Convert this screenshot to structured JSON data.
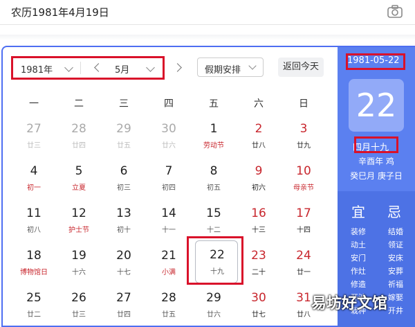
{
  "search": {
    "query": "农历1981年4月19日"
  },
  "toolbar": {
    "year": "1981年",
    "month": "5月",
    "holiday": "假期安排",
    "today": "返回今天"
  },
  "weekdays": [
    "一",
    "二",
    "三",
    "四",
    "五",
    "六",
    "日"
  ],
  "weeks": [
    [
      {
        "d": "27",
        "l": "廿三",
        "t": "gray"
      },
      {
        "d": "28",
        "l": "廿四",
        "t": "gray"
      },
      {
        "d": "29",
        "l": "廿五",
        "t": "gray"
      },
      {
        "d": "30",
        "l": "廿六",
        "t": "gray"
      },
      {
        "d": "1",
        "l": "劳动节",
        "t": "black",
        "lr": true
      },
      {
        "d": "2",
        "l": "廿八",
        "t": "red"
      },
      {
        "d": "3",
        "l": "廿九",
        "t": "red"
      }
    ],
    [
      {
        "d": "4",
        "l": "初一",
        "t": "black",
        "lr": true
      },
      {
        "d": "5",
        "l": "立夏",
        "t": "black",
        "lr": true
      },
      {
        "d": "6",
        "l": "初三",
        "t": "black"
      },
      {
        "d": "7",
        "l": "初四",
        "t": "black"
      },
      {
        "d": "8",
        "l": "初五",
        "t": "black"
      },
      {
        "d": "9",
        "l": "初六",
        "t": "red"
      },
      {
        "d": "10",
        "l": "母亲节",
        "t": "red",
        "lr": true
      }
    ],
    [
      {
        "d": "11",
        "l": "初八",
        "t": "black"
      },
      {
        "d": "12",
        "l": "护士节",
        "t": "black",
        "lr": true
      },
      {
        "d": "13",
        "l": "初十",
        "t": "black"
      },
      {
        "d": "14",
        "l": "十一",
        "t": "black"
      },
      {
        "d": "15",
        "l": "十二",
        "t": "black"
      },
      {
        "d": "16",
        "l": "十三",
        "t": "red"
      },
      {
        "d": "17",
        "l": "十四",
        "t": "red"
      }
    ],
    [
      {
        "d": "18",
        "l": "博物馆日",
        "t": "black",
        "lr": true
      },
      {
        "d": "19",
        "l": "十六",
        "t": "black"
      },
      {
        "d": "20",
        "l": "十七",
        "t": "black"
      },
      {
        "d": "21",
        "l": "小满",
        "t": "black",
        "lr": true
      },
      {
        "d": "22",
        "l": "十九",
        "t": "black",
        "sel": true
      },
      {
        "d": "23",
        "l": "二十",
        "t": "red"
      },
      {
        "d": "24",
        "l": "廿一",
        "t": "red"
      }
    ],
    [
      {
        "d": "25",
        "l": "廿二",
        "t": "black"
      },
      {
        "d": "26",
        "l": "廿三",
        "t": "black"
      },
      {
        "d": "27",
        "l": "廿四",
        "t": "black"
      },
      {
        "d": "28",
        "l": "廿五",
        "t": "black"
      },
      {
        "d": "29",
        "l": "廿六",
        "t": "black"
      },
      {
        "d": "30",
        "l": "廿七",
        "t": "red"
      },
      {
        "d": "31",
        "l": "廿八",
        "t": "red"
      }
    ]
  ],
  "side": {
    "date": "1981-05-22",
    "day": "22",
    "lunar": "四月十九",
    "ganzhi1": "辛酉年 鸡",
    "ganzhi2": "癸巳月 庚子日",
    "yi_title": "宜",
    "ji_title": "忌",
    "yi": [
      "装修",
      "动土",
      "安门",
      "作灶",
      "修造",
      "开池",
      "栽种"
    ],
    "ji": [
      "结婚",
      "领证",
      "安床",
      "安葬",
      "祈福",
      "嫁娶",
      "开井"
    ]
  },
  "watermark": "易坊好文馆",
  "colors": {
    "accent": "#4e6ef2",
    "highlight": "#d9112a",
    "holiday_red": "#c8262d"
  }
}
